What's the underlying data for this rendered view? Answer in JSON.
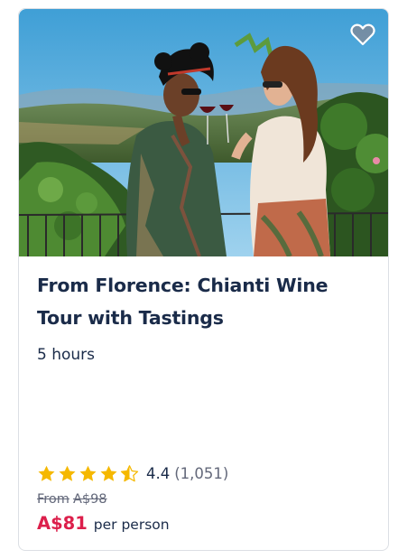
{
  "card": {
    "image_alt": "Two women toasting with red wine in a vineyard",
    "wishlist_icon": "heart-icon",
    "title": "From Florence: Chianti Wine Tour with Tastings",
    "duration": "5 hours",
    "rating": {
      "stars": 4.4,
      "value": "4.4",
      "count": "(1,051)",
      "star_color": "#f5b800"
    },
    "price": {
      "from_label": "From",
      "original": "A$98",
      "current": "A$81",
      "unit": "per person",
      "accent_color": "#dc1f4b"
    }
  }
}
